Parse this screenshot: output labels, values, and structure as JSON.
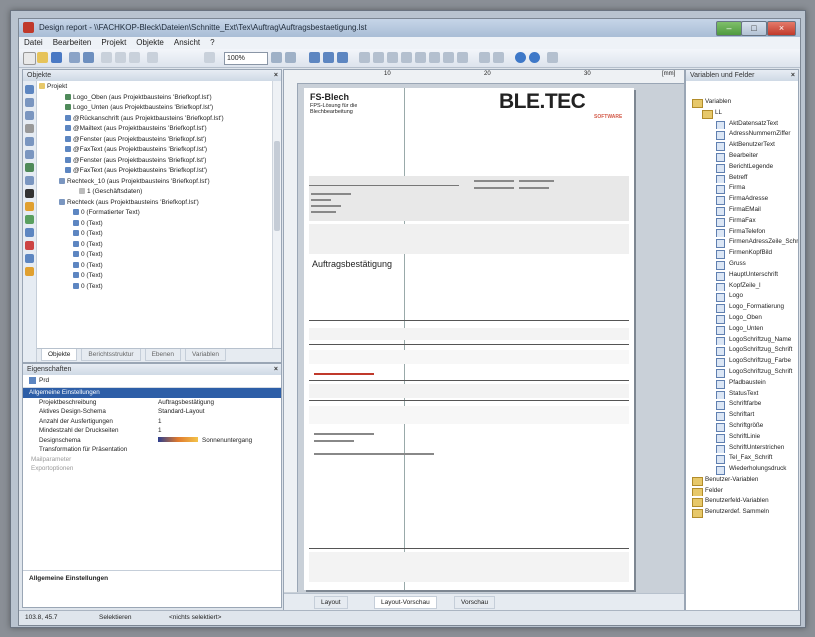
{
  "window": {
    "title": "Design report - \\\\FACHKOP-Bleck\\Dateien\\Schnitte_Ext\\Tex\\Auftrag\\Auftragsbestaetigung.lst"
  },
  "menu": [
    "Datei",
    "Bearbeiten",
    "Projekt",
    "Objekte",
    "Ansicht",
    "?"
  ],
  "toolbar": {
    "zoom": "100%"
  },
  "objects_panel": {
    "title": "Objekte",
    "root": "Projekt",
    "items": [
      "Logo_Oben (aus Projektbausteins 'Briefkopf.lst')",
      "Logo_Unten (aus Projektbausteins 'Briefkopf.lst')",
      "@Rückanschrift (aus Projektbausteins 'Briefkopf.lst')",
      "@Mailtext (aus Projektbausteins 'Briefkopf.lst')",
      "@Fenster (aus Projektbausteins 'Briefkopf.lst')",
      "@FaxText (aus Projektbausteins 'Briefkopf.lst')",
      "@Fenster (aus Projektbausteins 'Briefkopf.lst')",
      "@FaxText (aus Projektbausteins 'Briefkopf.lst')",
      "Rechteck_10 (aus Projektbausteins 'Briefkopf.lst')",
      "1 (Geschäftsdaten)",
      "Rechteck (aus Projektbausteins 'Briefkopf.lst')",
      "0 (Formatierter Text)",
      "0 (Text)",
      "0 (Text)",
      "0 (Text)",
      "0 (Text)",
      "0 (Text)",
      "0 (Text)",
      "0 (Text)"
    ],
    "tabs": [
      "Objekte",
      "Berichtsstruktur",
      "Ebenen",
      "Variablen"
    ]
  },
  "properties_panel": {
    "title": "Eigenschaften",
    "subtitle": "Prd",
    "category": "Allgemeine Einstellungen",
    "rows": [
      {
        "key": "Projektbeschreibung",
        "value": "Auftragsbestätigung"
      },
      {
        "key": "Aktives Design-Schema",
        "value": "Standard-Layout"
      },
      {
        "key": "Anzahl der Ausfertigungen",
        "value": "1"
      },
      {
        "key": "Mindestzahl der Druckseiten",
        "value": "1"
      },
      {
        "key": "Designschema",
        "value": "Sonnenuntergang"
      },
      {
        "key": "Transformation für Präsentation",
        "value": ""
      }
    ],
    "collapsed": [
      "Mailparameter",
      "Exportoptionen"
    ],
    "footer": "Allgemeine Einstellungen"
  },
  "document": {
    "company": "FS-Blech",
    "company_sub": [
      "FPS-Lösung für die",
      "Blechbearbeitung"
    ],
    "logo": "BLE.TEC",
    "logo_sub": "SOFTWARE",
    "doc_title": "Auftragsbestätigung"
  },
  "preview_tabs": [
    "Layout",
    "Layout-Vorschau",
    "Vorschau"
  ],
  "variables_panel": {
    "title": "Variablen und Felder",
    "items": [
      "Variablen",
      "LL",
      "AktDatensatzText",
      "AdressNummernZiffer",
      "AktBenutzerText",
      "Bearbeiter",
      "BerichtLegende",
      "Betreff",
      "Firma",
      "FirmaAdresse",
      "FirmaEMail",
      "FirmaFax",
      "FirmaTelefon",
      "FirmenAdressZeile_Schrift",
      "FirmenKopfBild",
      "Gruss",
      "HauptUnterschrift",
      "KopfZeile_l",
      "Logo",
      "Logo_Formatierung",
      "Logo_Oben",
      "Logo_Unten",
      "LogoSchriftzug_Name",
      "LogoSchriftzug_Schrift",
      "LogoSchriftzug_Farbe",
      "LogoSchriftzug_Schrift",
      "Pfadbaustein",
      "StatusText",
      "Schriftfarbe",
      "Schriftart",
      "Schriftgröße",
      "SchriftLinie",
      "SchriftUnterstrichen",
      "Tel_Fax_Schrift",
      "Wiederholungsdruck",
      "Benutzer-Variablen",
      "Felder",
      "Benutzerfeld-Variablen",
      "Benutzerdef. Sammeln"
    ]
  },
  "statusbar": {
    "coords": "103.8, 45.7",
    "mode": "Selektieren",
    "info": "<nichts selektiert>"
  }
}
